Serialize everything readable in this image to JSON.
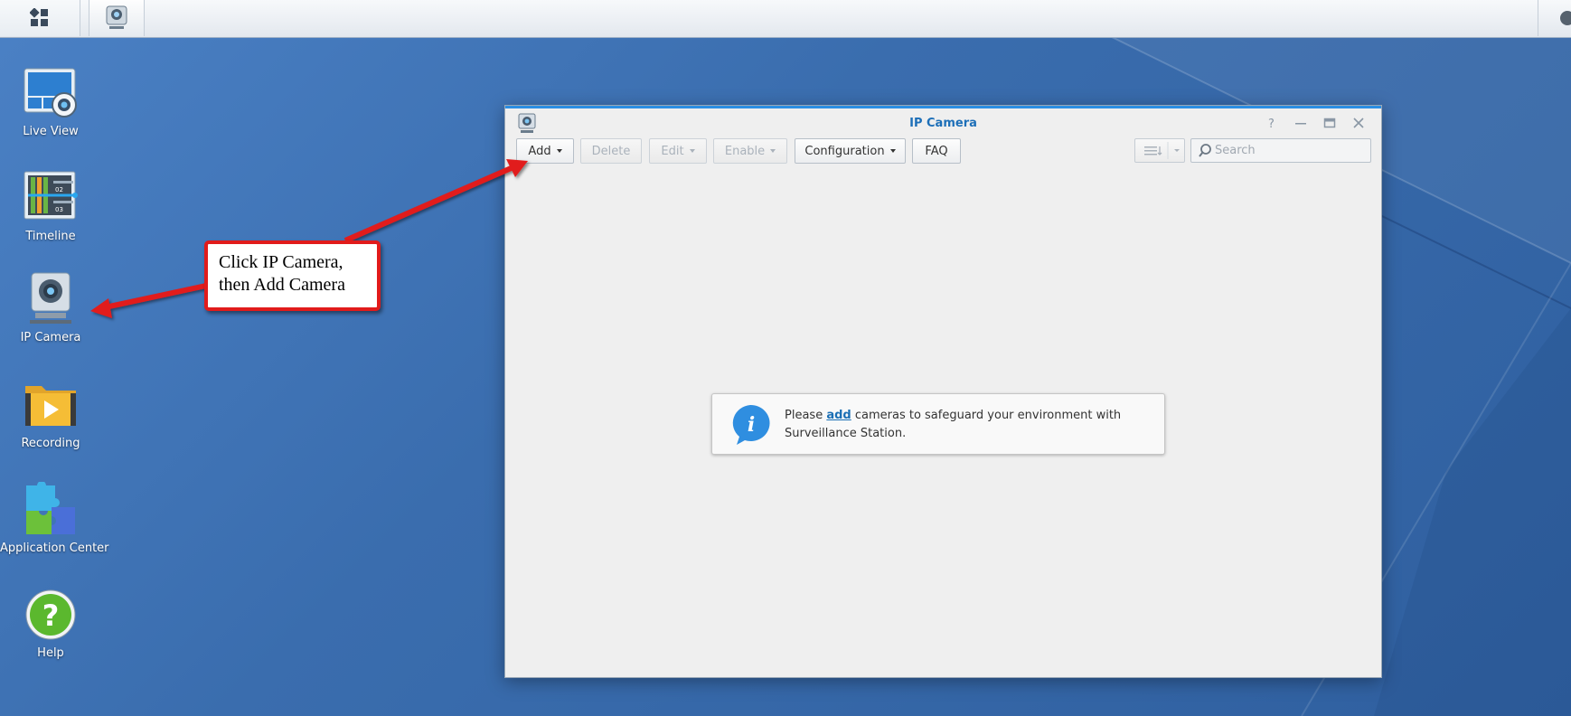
{
  "taskbar": {
    "main_menu_icon": "grid-icon",
    "active_app_icon": "ip-camera-icon"
  },
  "desktop": {
    "icons": [
      {
        "label": "Live View",
        "icon": "live-view-icon"
      },
      {
        "label": "Timeline",
        "icon": "timeline-icon",
        "markers": [
          "02",
          "03"
        ]
      },
      {
        "label": "IP Camera",
        "icon": "ip-camera-icon"
      },
      {
        "label": "Recording",
        "icon": "recording-folder-icon"
      },
      {
        "label": "Application Center",
        "icon": "puzzle-icon"
      },
      {
        "label": "Help",
        "icon": "help-icon"
      }
    ]
  },
  "window": {
    "title": "IP Camera",
    "toolbar": {
      "add": "Add",
      "delete": "Delete",
      "edit": "Edit",
      "enable": "Enable",
      "configuration": "Configuration",
      "faq": "FAQ"
    },
    "search": {
      "placeholder": "Search",
      "value": ""
    },
    "empty": {
      "before": "Please ",
      "link": "add",
      "after": " cameras to safeguard your environment with Surveillance Station."
    },
    "accent": "#2b8ee3"
  },
  "annotation": {
    "line1": "Click IP Camera,",
    "line2": "then Add Camera",
    "color": "#e11b1b"
  }
}
